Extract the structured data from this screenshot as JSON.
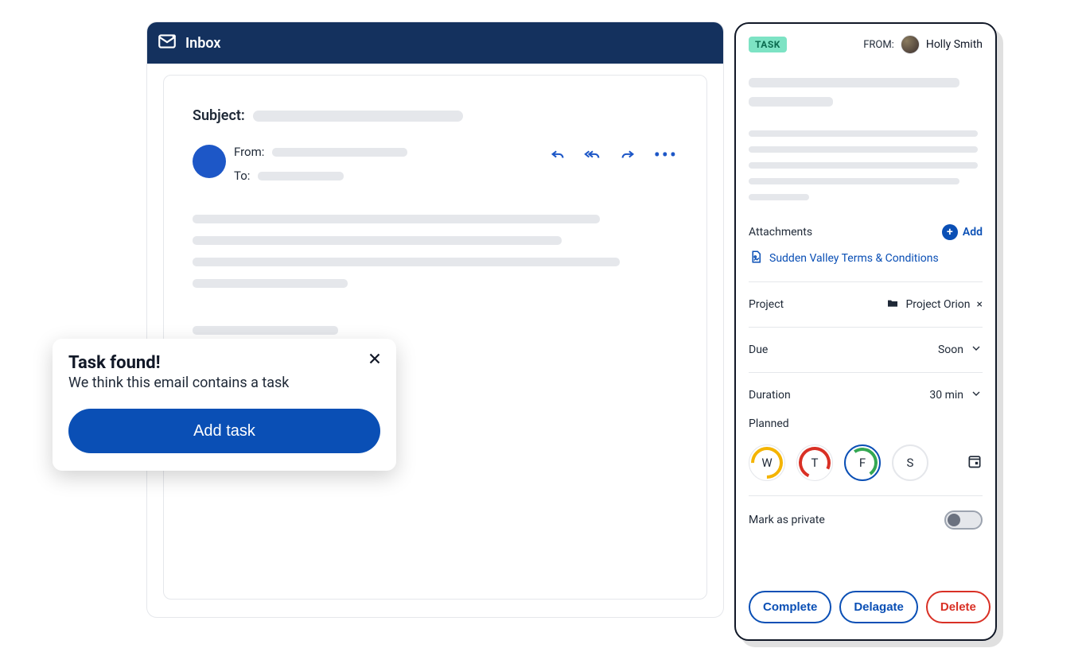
{
  "inbox": {
    "title": "Inbox",
    "subject_label": "Subject:",
    "from_label": "From:",
    "to_label": "To:"
  },
  "popup": {
    "title": "Task found!",
    "subtitle": "We think this email contains a task",
    "button": "Add task"
  },
  "panel": {
    "badge": "TASK",
    "from_label": "FROM:",
    "sender": "Holly Smith",
    "attachments": {
      "heading": "Attachments",
      "add_label": "Add",
      "file": "Sudden Valley Terms & Conditions"
    },
    "project": {
      "label": "Project",
      "value": "Project Orion"
    },
    "due": {
      "label": "Due",
      "value": "Soon"
    },
    "duration": {
      "label": "Duration",
      "value": "30 min"
    },
    "planned": {
      "label": "Planned",
      "days": [
        "W",
        "T",
        "F",
        "S"
      ]
    },
    "private_label": "Mark as private",
    "actions": {
      "complete": "Complete",
      "delegate": "Delagate",
      "delete": "Delete"
    }
  }
}
